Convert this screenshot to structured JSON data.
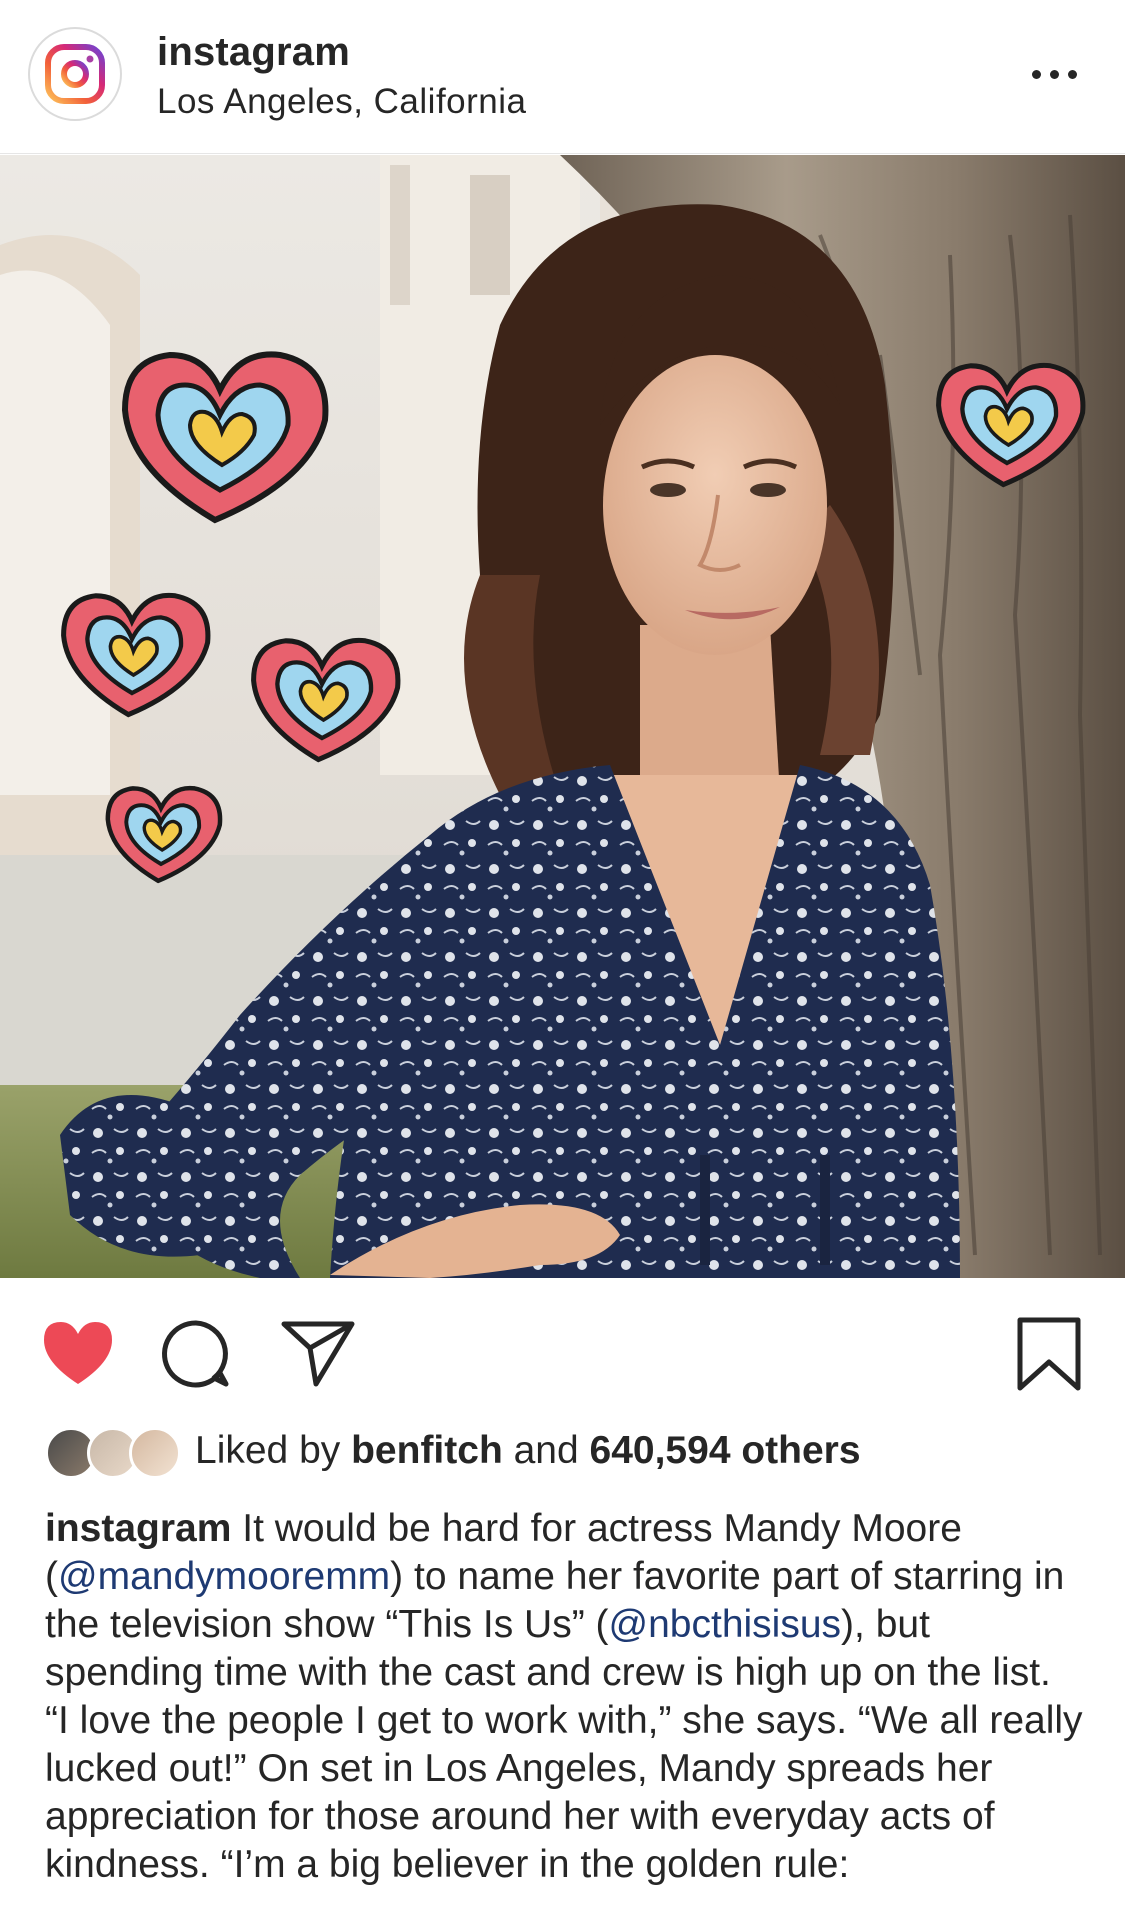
{
  "header": {
    "account_name": "instagram",
    "location": "Los Angeles, California",
    "logo_icon": "instagram-logo-icon",
    "more_icon": "more-horizontal-icon"
  },
  "photo": {
    "alt": "Woman in floral navy dress standing by a tree with drawn hearts"
  },
  "actions": {
    "like_icon": "heart-filled-icon",
    "comment_icon": "comment-icon",
    "share_icon": "paper-plane-icon",
    "save_icon": "bookmark-icon",
    "like_color": "#ed4956"
  },
  "likes": {
    "prefix": "Liked by ",
    "user": "benfitch",
    "middle": " and ",
    "count": "640,594 others"
  },
  "caption": {
    "author": "instagram",
    "part1": " It would be hard for actress Mandy Moore (",
    "mention1": "@mandymooremm",
    "part2": ") to name her favorite part of starring in the television show “This Is Us” (",
    "mention2": "@nbcthisisus",
    "part3": "), but spending time with the cast and crew is high up on the list. “I love the people I get to work with,” she says. “We all really lucked out!” On set in Los Angeles, Mandy spreads her appreciation for those around her with everyday acts of kindness. “I’m a big believer in the golden rule:"
  },
  "colors": {
    "text": "#262626",
    "mention": "#1e3a73",
    "divider": "#e6e6e6"
  }
}
